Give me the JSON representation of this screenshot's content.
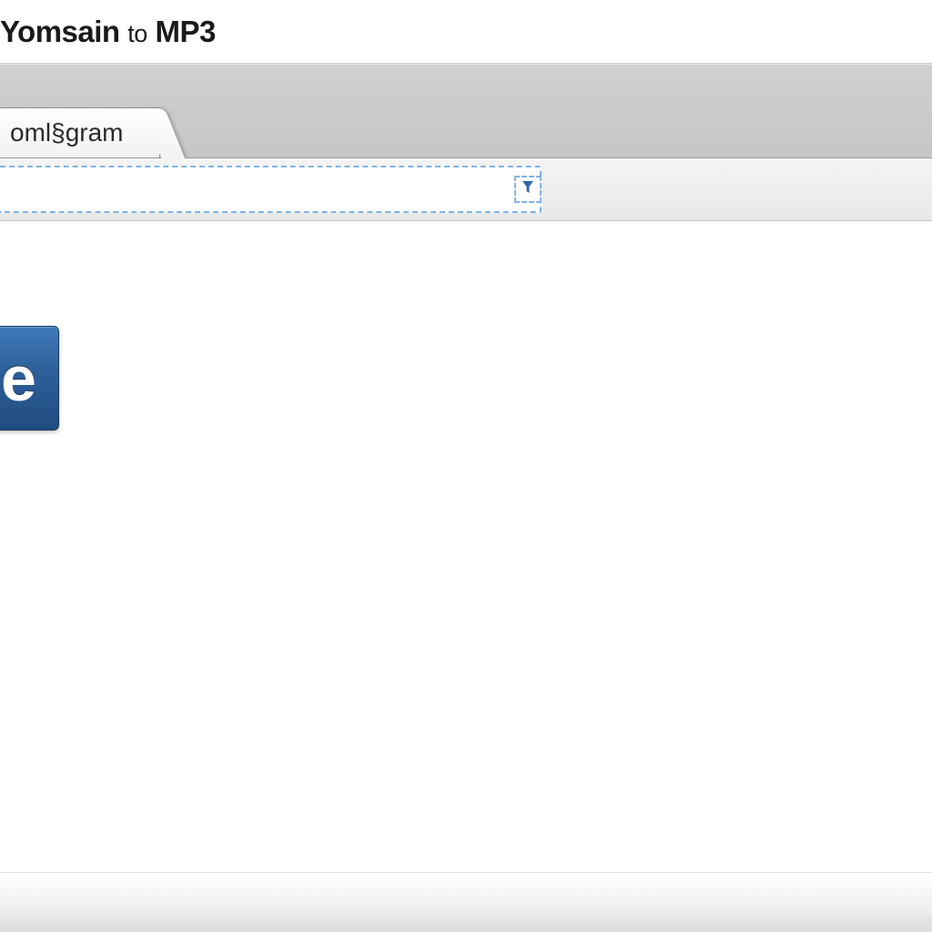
{
  "window": {
    "title_prefix": "Yomsain",
    "title_mid": "to",
    "title_suffix": "MP3"
  },
  "tabs": [
    {
      "label": "oml§gram"
    }
  ],
  "address_bar": {
    "value": "",
    "filter_icon": "filter"
  },
  "main": {
    "primary_button_label": "e"
  },
  "colors": {
    "accent_blue": "#2d5f99",
    "dashed_blue": "#7fb3e6",
    "toolbar_gray": "#c6c6c6"
  }
}
